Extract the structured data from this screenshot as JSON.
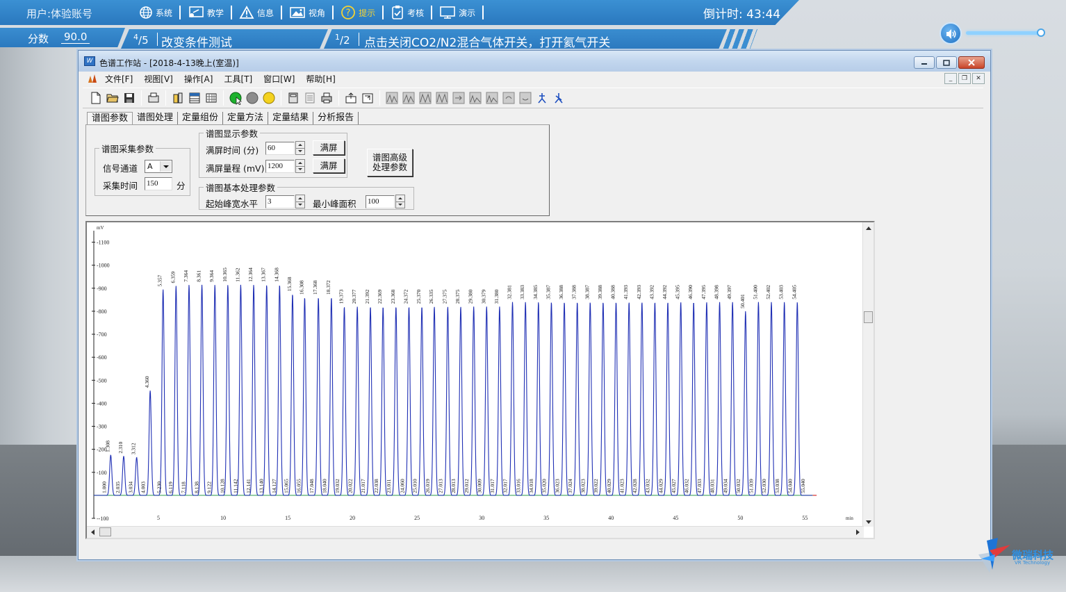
{
  "hud": {
    "user": "用户:体验账号",
    "score_label": "分数",
    "score_value": "90.0",
    "menu": [
      {
        "label": "系统",
        "icon": "globe-icon"
      },
      {
        "label": "教学",
        "icon": "teach-icon"
      },
      {
        "label": "信息",
        "icon": "warning-icon"
      },
      {
        "label": "视角",
        "icon": "image-icon"
      },
      {
        "label": "提示",
        "icon": "question-icon"
      },
      {
        "label": "考核",
        "icon": "clipboard-check-icon"
      },
      {
        "label": "演示",
        "icon": "monitor-icon"
      }
    ],
    "timer": "倒计时: 43:44",
    "step_major_num": "4",
    "step_major_den": "5",
    "step_major_text": "改变条件测试",
    "step_minor_num": "1",
    "step_minor_den": "2",
    "step_minor_text": "点击关闭CO2/N2混合气体开关，打开氦气开关",
    "volume_level": 0.97
  },
  "window": {
    "title": "色谱工作站 - [2018-4-13晚上(室温)]",
    "menu": [
      "文件[F]",
      "视图[V]",
      "操作[A]",
      "工具[T]",
      "窗口[W]",
      "帮助[H]"
    ]
  },
  "tabs": [
    "谱图参数",
    "谱图处理",
    "定量组份",
    "定量方法",
    "定量结果",
    "分析报告"
  ],
  "params": {
    "acq_group": "谱图采集参数",
    "signal_channel_label": "信号通道",
    "signal_channel_value": "A",
    "acq_time_label": "采集时间",
    "acq_time_value": "150",
    "acq_time_unit": "分",
    "display_group": "谱图显示参数",
    "full_time_label": "满屏时间 (分)",
    "full_time_value": "60",
    "full_range_label": "满屏量程 (mV)",
    "full_range_value": "1200",
    "full_btn": "满屏",
    "basic_group": "谱图基本处理参数",
    "peak_width_label": "起始峰宽水平",
    "peak_width_value": "3",
    "min_area_label": "最小峰面积",
    "min_area_value": "100",
    "advanced_btn_line1": "谱图高级",
    "advanced_btn_line2": "处理参数"
  },
  "chart_data": {
    "type": "line",
    "ylabel": "mV",
    "xlabel": "min",
    "xlim": [
      0,
      56
    ],
    "ylim": [
      -100,
      1150
    ],
    "yticks": [
      1100,
      1000,
      900,
      800,
      700,
      600,
      500,
      400,
      300,
      200,
      100,
      -100
    ],
    "xticks": [
      5,
      10,
      15,
      20,
      25,
      30,
      35,
      40,
      45,
      50,
      55
    ],
    "peaks": [
      {
        "t": 1.308,
        "h": 175,
        "label": "1.308"
      },
      {
        "t": 2.31,
        "h": 170,
        "label": "2.310"
      },
      {
        "t": 3.312,
        "h": 165,
        "label": "3.312"
      },
      {
        "t": 4.36,
        "h": 455,
        "label": "4.360"
      },
      {
        "t": 5.357,
        "h": 895,
        "label": "5.357"
      },
      {
        "t": 6.359,
        "h": 910,
        "label": "6.359"
      },
      {
        "t": 7.364,
        "h": 915,
        "label": "7.364"
      },
      {
        "t": 8.361,
        "h": 915,
        "label": "8.361"
      },
      {
        "t": 9.364,
        "h": 915,
        "label": "9.364"
      },
      {
        "t": 10.365,
        "h": 915,
        "label": "10.365"
      },
      {
        "t": 11.362,
        "h": 915,
        "label": "11.362"
      },
      {
        "t": 12.364,
        "h": 915,
        "label": "12.364"
      },
      {
        "t": 13.367,
        "h": 915,
        "label": "13.367"
      },
      {
        "t": 14.368,
        "h": 915,
        "label": "14.368"
      },
      {
        "t": 15.368,
        "h": 875,
        "label": "15.368"
      },
      {
        "t": 16.308,
        "h": 860,
        "label": "16.308"
      },
      {
        "t": 17.368,
        "h": 860,
        "label": "17.368"
      },
      {
        "t": 18.372,
        "h": 860,
        "label": "18.372"
      },
      {
        "t": 19.373,
        "h": 820,
        "label": "19.373"
      },
      {
        "t": 20.377,
        "h": 820,
        "label": "20.377"
      },
      {
        "t": 21.392,
        "h": 820,
        "label": "21.392"
      },
      {
        "t": 22.369,
        "h": 820,
        "label": "22.369"
      },
      {
        "t": 23.368,
        "h": 820,
        "label": "23.368"
      },
      {
        "t": 24.372,
        "h": 820,
        "label": "24.372"
      },
      {
        "t": 25.37,
        "h": 820,
        "label": "25.370"
      },
      {
        "t": 26.335,
        "h": 820,
        "label": "26.335"
      },
      {
        "t": 27.375,
        "h": 820,
        "label": "27.375"
      },
      {
        "t": 28.375,
        "h": 820,
        "label": "28.375"
      },
      {
        "t": 29.38,
        "h": 820,
        "label": "29.380"
      },
      {
        "t": 30.379,
        "h": 820,
        "label": "30.379"
      },
      {
        "t": 31.38,
        "h": 820,
        "label": "31.380"
      },
      {
        "t": 32.381,
        "h": 840,
        "label": "32.381"
      },
      {
        "t": 33.383,
        "h": 840,
        "label": "33.383"
      },
      {
        "t": 34.385,
        "h": 840,
        "label": "34.385"
      },
      {
        "t": 35.387,
        "h": 840,
        "label": "35.387"
      },
      {
        "t": 36.388,
        "h": 840,
        "label": "36.388"
      },
      {
        "t": 37.388,
        "h": 840,
        "label": "37.388"
      },
      {
        "t": 38.387,
        "h": 840,
        "label": "38.387"
      },
      {
        "t": 39.388,
        "h": 840,
        "label": "39.388"
      },
      {
        "t": 40.388,
        "h": 840,
        "label": "40.388"
      },
      {
        "t": 41.393,
        "h": 840,
        "label": "41.393"
      },
      {
        "t": 42.393,
        "h": 840,
        "label": "42.393"
      },
      {
        "t": 43.392,
        "h": 840,
        "label": "43.392"
      },
      {
        "t": 44.392,
        "h": 840,
        "label": "44.392"
      },
      {
        "t": 45.395,
        "h": 840,
        "label": "45.395"
      },
      {
        "t": 46.39,
        "h": 840,
        "label": "46.390"
      },
      {
        "t": 47.395,
        "h": 840,
        "label": "47.395"
      },
      {
        "t": 48.398,
        "h": 840,
        "label": "48.398"
      },
      {
        "t": 49.397,
        "h": 840,
        "label": "49.397"
      },
      {
        "t": 50.401,
        "h": 800,
        "label": "50.401"
      },
      {
        "t": 51.4,
        "h": 840,
        "label": "51.400"
      },
      {
        "t": 52.402,
        "h": 840,
        "label": "52.402"
      },
      {
        "t": 53.403,
        "h": 840,
        "label": "53.403"
      },
      {
        "t": 54.405,
        "h": 840,
        "label": "54.405"
      }
    ],
    "valleys": [
      "1.000",
      "2.035",
      "3.034",
      "4.003",
      "5.230",
      "6.119",
      "7.118",
      "8.138",
      "9.122",
      "10.128",
      "11.142",
      "12.141",
      "13.140",
      "14.127",
      "15.065",
      "16.055",
      "17.048",
      "18.040",
      "19.032",
      "20.022",
      "21.017",
      "22.038",
      "23.011",
      "24.060",
      "25.010",
      "26.019",
      "27.013",
      "28.013",
      "29.012",
      "30.009",
      "31.017",
      "32.017",
      "33.016",
      "34.018",
      "35.020",
      "36.023",
      "37.024",
      "38.023",
      "39.022",
      "40.029",
      "41.023",
      "42.028",
      "43.032",
      "44.029",
      "45.027",
      "46.032",
      "47.033",
      "48.031",
      "49.034",
      "50.032",
      "51.039",
      "52.030",
      "53.038",
      "54.040",
      "55.040"
    ],
    "colors": {
      "line": "#1f2fb4",
      "baseline": "#2a9a4a",
      "axis": "#222"
    }
  },
  "brand": {
    "name": "微瑞科技",
    "sub": "VR Technology"
  }
}
